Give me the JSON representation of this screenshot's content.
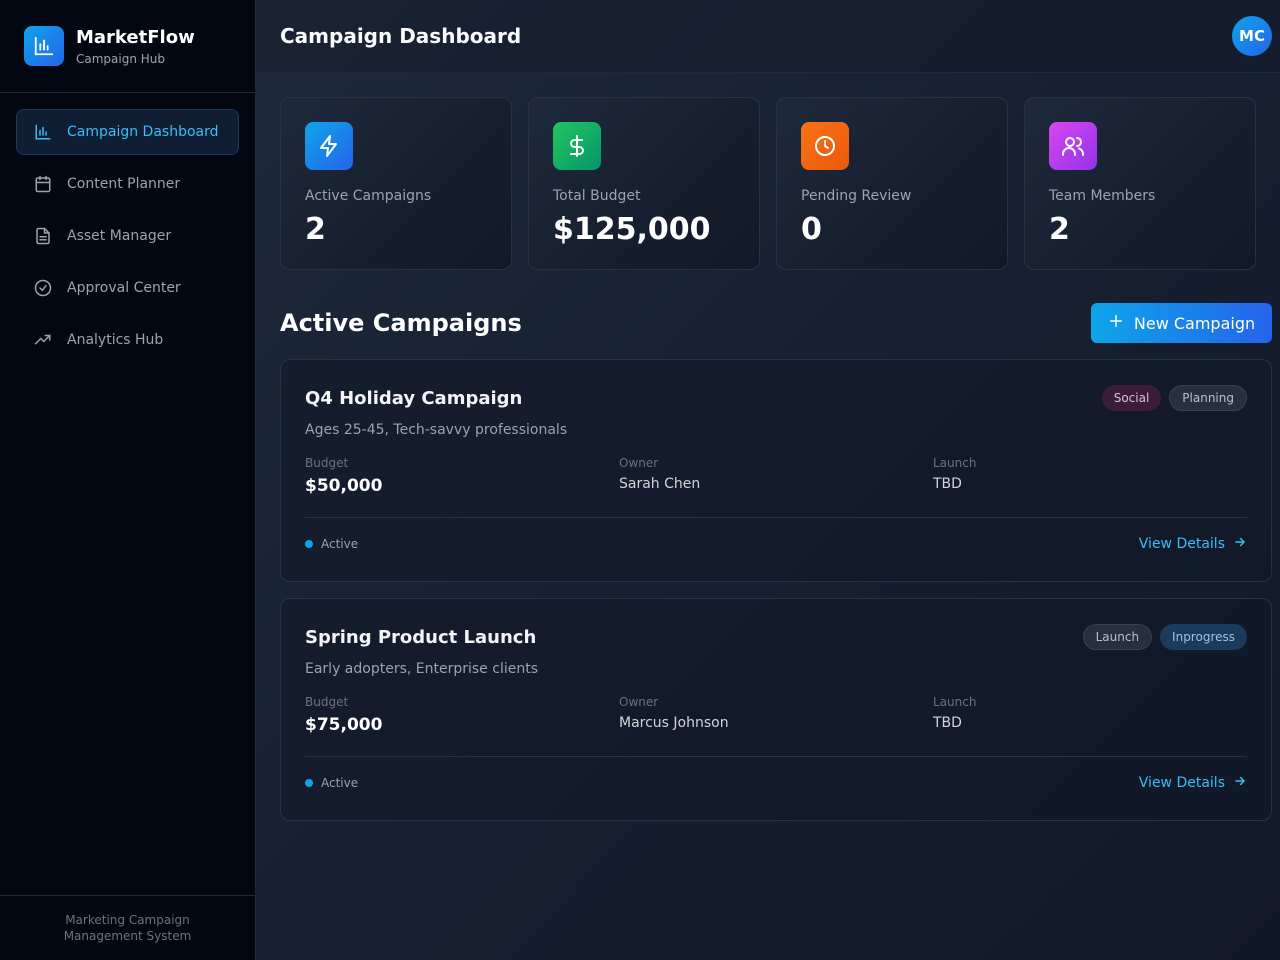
{
  "brand": {
    "name": "MarketFlow",
    "subtitle": "Campaign Hub",
    "logo_icon": "bar-chart-icon",
    "accent_gradient": [
      "#0ea5e9",
      "#2563eb"
    ]
  },
  "sidebar": {
    "items": [
      {
        "label": "Campaign Dashboard",
        "icon": "bar-chart-icon",
        "active": true
      },
      {
        "label": "Content Planner",
        "icon": "calendar-icon",
        "active": false
      },
      {
        "label": "Asset Manager",
        "icon": "document-icon",
        "active": false
      },
      {
        "label": "Approval Center",
        "icon": "check-circle-icon",
        "active": false
      },
      {
        "label": "Analytics Hub",
        "icon": "trending-up-icon",
        "active": false
      }
    ],
    "footer": "Marketing Campaign Management System"
  },
  "header": {
    "title": "Campaign Dashboard",
    "avatar_initials": "MC"
  },
  "stats": [
    {
      "label": "Active Campaigns",
      "value": "2",
      "icon": "lightning-icon",
      "color": "#0ea5e9"
    },
    {
      "label": "Total Budget",
      "value": "$125,000",
      "icon": "dollar-icon",
      "color": "#16a34a"
    },
    {
      "label": "Pending Review",
      "value": "0",
      "icon": "clock-icon",
      "color": "#f97316"
    },
    {
      "label": "Team Members",
      "value": "2",
      "icon": "users-icon",
      "color": "#c026d3"
    }
  ],
  "campaigns_section": {
    "title": "Active Campaigns",
    "new_button_label": "New Campaign"
  },
  "campaigns": [
    {
      "title": "Q4 Holiday Campaign",
      "tags": [
        "Social",
        "Planning"
      ],
      "audience": "Ages 25-45, Tech-savvy professionals",
      "budget_label": "Budget",
      "budget": "$50,000",
      "owner_label": "Owner",
      "owner": "Sarah Chen",
      "launch_label": "Launch",
      "launch": "TBD",
      "status": "Active",
      "link_label": "View Details"
    },
    {
      "title": "Spring Product Launch",
      "tags": [
        "Launch",
        "Inprogress"
      ],
      "audience": "Early adopters, Enterprise clients",
      "budget_label": "Budget",
      "budget": "$75,000",
      "owner_label": "Owner",
      "owner": "Marcus Johnson",
      "launch_label": "Launch",
      "launch": "TBD",
      "status": "Active",
      "link_label": "View Details"
    }
  ]
}
